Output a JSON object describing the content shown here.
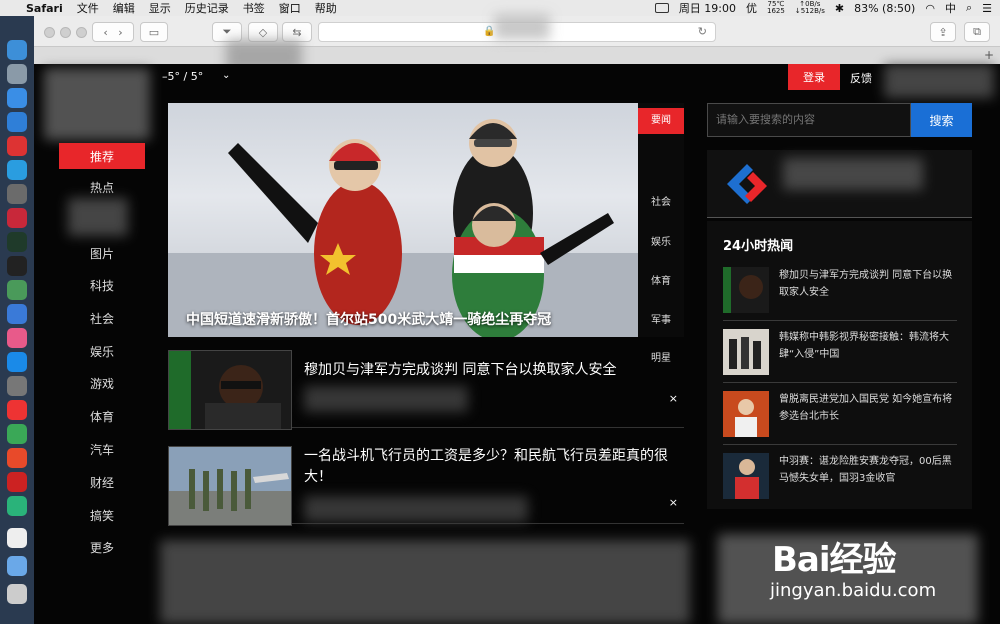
{
  "menubar": {
    "app": "Safari",
    "items": [
      "文件",
      "编辑",
      "显示",
      "历史记录",
      "书签",
      "窗口",
      "帮助"
    ],
    "clock": "周日 19:00",
    "ime": "优",
    "temp_cpu": "75℃",
    "temp_sub": "1625",
    "net_up": "↑0B/s",
    "net_down": "↓512B/s",
    "battery": "83% (8:50)",
    "lang": "中"
  },
  "page": {
    "temperature_range": "–5° / 5°",
    "login": "登录",
    "feedback": "反馈",
    "nav": {
      "active": "推荐",
      "items": [
        "热点",
        "图片",
        "科技",
        "社会",
        "娱乐",
        "游戏",
        "体育",
        "汽车",
        "财经",
        "搞笑",
        "更多"
      ]
    },
    "hero": {
      "title": "中国短道速滑新骄傲！首尔站500米武大靖一骑绝尘再夺冠",
      "tabs": [
        "要闻",
        "社会",
        "娱乐",
        "体育",
        "军事",
        "明星"
      ]
    },
    "news": [
      {
        "title": "穆加贝与津军方完成谈判 同意下台以换取家人安全"
      },
      {
        "title": "一名战斗机飞行员的工资是多少？和民航飞行员差距真的很大！"
      }
    ],
    "close": "×",
    "search": {
      "placeholder": "请输入要搜索的内容",
      "button": "搜索"
    },
    "hot": {
      "title": "24小时热闻",
      "items": [
        {
          "text": "穆加贝与津军方完成谈判 同意下台以换取家人安全"
        },
        {
          "text": "韩媒称中韩影视界秘密接触：韩流将大肆“入侵”中国"
        },
        {
          "text": "曾脱离民进党加入国民党 如今她宣布将参选台北市长"
        },
        {
          "text": "中羽赛：谌龙险胜安赛龙夺冠，00后黑马憾失女单，国羽3金收官"
        }
      ]
    },
    "watermark": {
      "brand": "Bai经验",
      "url": "jingyan.baidu.com"
    }
  }
}
